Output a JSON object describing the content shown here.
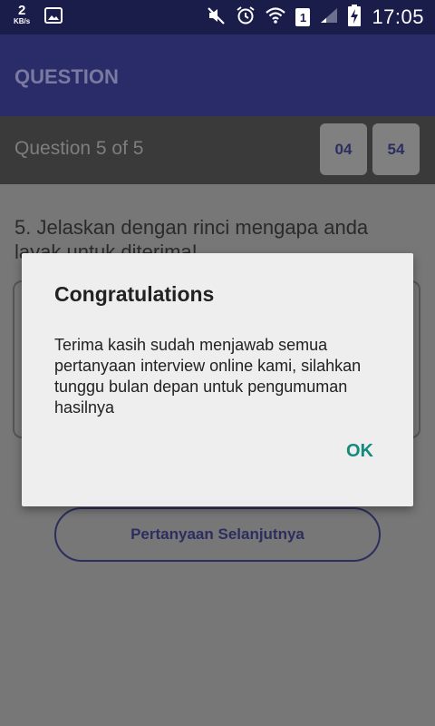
{
  "status_bar": {
    "net_speed_value": "2",
    "net_speed_unit": "KB/s",
    "time": "17:05",
    "sim_slot": "1",
    "icons": [
      "gallery-icon",
      "mute-icon",
      "alarm-icon",
      "wifi-icon",
      "sim-icon",
      "signal-icon",
      "battery-charging-icon"
    ]
  },
  "app_bar": {
    "title": "QUESTION"
  },
  "question_bar": {
    "progress": "Question 5 of 5",
    "timer_minutes": "04",
    "timer_seconds": "54"
  },
  "content": {
    "question_text": "5. Jelaskan dengan rinci mengapa anda layak untuk diterima!",
    "answer_value": "",
    "next_button_label": "Pertanyaan Selanjutnya"
  },
  "dialog": {
    "title": "Congratulations",
    "message": "Terima kasih sudah menjawab semua pertanyaan interview online kami, silahkan tunggu bulan depan untuk pengumuman hasilnya",
    "ok_label": "OK"
  },
  "colors": {
    "status_bar": "#1a1c4a",
    "app_bar": "#2a2c6a",
    "accent": "#128a7e",
    "primary_text": "#2c2e60"
  }
}
